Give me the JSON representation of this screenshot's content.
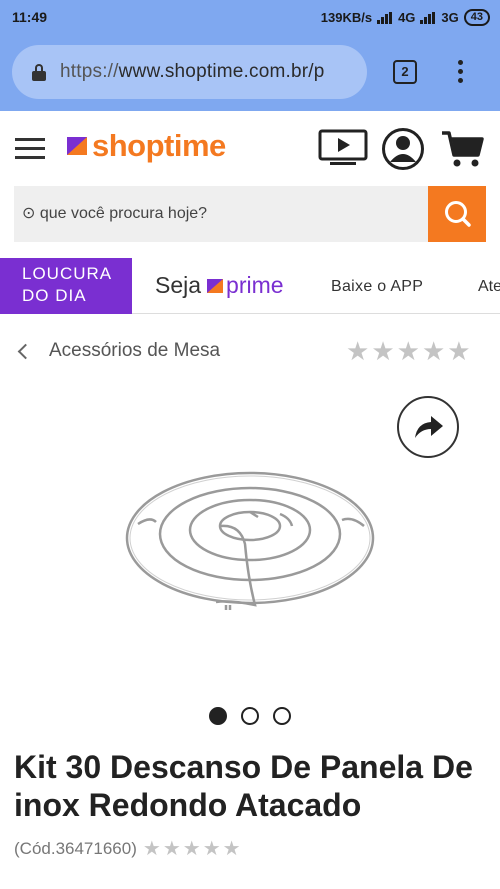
{
  "status_bar": {
    "time": "11:49",
    "speed": "139KB/s",
    "net1": "4G",
    "net2": "3G",
    "battery": "43"
  },
  "browser": {
    "url_scheme": "https://",
    "url_rest": "www.shoptime.com.br/p",
    "tab_count": "2"
  },
  "header": {
    "logo_text": "shoptime"
  },
  "search": {
    "placeholder": "⊙ que você procura hoje?"
  },
  "nav": {
    "loucura_line1": "LOUCURA",
    "loucura_line2": "DO DIA",
    "seja_label": "Seja",
    "prime_label": "prime",
    "baixe_label": "Baixe o APP",
    "next_label": "Ate"
  },
  "breadcrumb": {
    "label": "Acessórios de Mesa"
  },
  "rating": {
    "stars": 0,
    "max": 5
  },
  "gallery": {
    "image_count": 3,
    "active_index": 0
  },
  "product": {
    "title": "Kit 30 Descanso De Panela De inox Redondo Atacado",
    "code": "(Cód.36471660)"
  },
  "colors": {
    "brand_orange": "#f47920",
    "brand_purple": "#7a2fd1",
    "browser_blue": "#7fa8f0"
  }
}
